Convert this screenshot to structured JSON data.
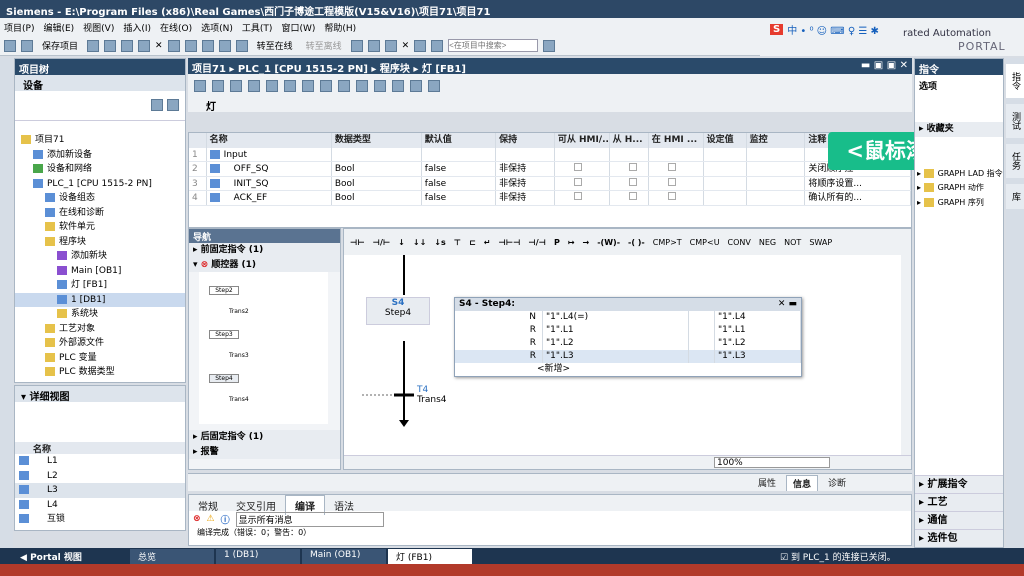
{
  "titlebar": {
    "app": "Siemens",
    "path": "E:\\Program Files (x86)\\Real Games\\西门子博途工程模版(V15&V16)\\项目71\\项目71"
  },
  "menu": [
    "项目(P)",
    "编辑(E)",
    "视图(V)",
    "插入(I)",
    "在线(O)",
    "选项(N)",
    "工具(T)",
    "窗口(W)",
    "帮助(H)"
  ],
  "toolbar": {
    "save": "保存项目",
    "go_online": "转至在线",
    "go_offline": "转至离线",
    "search_placeholder": "<在项目中搜索>"
  },
  "brand": {
    "line1": "rated Automation",
    "line2": "PORTAL"
  },
  "ime": {
    "logo": "S",
    "text": "中 • ⁰ ☺ ⌨ ♀ ☰ ✱"
  },
  "project_tree": {
    "title": "项目树",
    "tab": "设备",
    "items": [
      {
        "label": "项目71",
        "indent": 0,
        "icon": "folder"
      },
      {
        "label": "添加新设备",
        "indent": 1,
        "icon": "add-device"
      },
      {
        "label": "设备和网络",
        "indent": 1,
        "icon": "network"
      },
      {
        "label": "PLC_1 [CPU 1515-2 PN]",
        "indent": 1,
        "icon": "plc"
      },
      {
        "label": "设备组态",
        "indent": 2,
        "icon": "config"
      },
      {
        "label": "在线和诊断",
        "indent": 2,
        "icon": "diag"
      },
      {
        "label": "软件单元",
        "indent": 2,
        "icon": "folder"
      },
      {
        "label": "程序块",
        "indent": 2,
        "icon": "folder"
      },
      {
        "label": "添加新块",
        "indent": 3,
        "icon": "add"
      },
      {
        "label": "Main [OB1]",
        "indent": 3,
        "icon": "ob"
      },
      {
        "label": "灯 [FB1]",
        "indent": 3,
        "icon": "fb"
      },
      {
        "label": "1 [DB1]",
        "indent": 3,
        "icon": "db"
      },
      {
        "label": "系统块",
        "indent": 3,
        "icon": "folder"
      },
      {
        "label": "工艺对象",
        "indent": 2,
        "icon": "folder"
      },
      {
        "label": "外部源文件",
        "indent": 2,
        "icon": "folder"
      },
      {
        "label": "PLC 变量",
        "indent": 2,
        "icon": "folder"
      },
      {
        "label": "PLC 数据类型",
        "indent": 2,
        "icon": "folder"
      }
    ]
  },
  "detail_view": {
    "title": "详细视图",
    "column": "名称",
    "items": [
      "L1",
      "L2",
      "L3",
      "L4",
      "互锁"
    ]
  },
  "editor": {
    "breadcrumb": [
      "项目71",
      "PLC_1 [CPU 1515-2 PN]",
      "程序块",
      "灯 [FB1]"
    ],
    "block_name": "灯"
  },
  "interface": {
    "headers": [
      "名称",
      "数据类型",
      "默认值",
      "保持",
      "可从 HMI/...",
      "从 H...",
      "在 HMI ...",
      "设定值",
      "监控",
      "注释"
    ],
    "rows": [
      {
        "num": "1",
        "name": "Input",
        "type": "",
        "default": "",
        "retain": "",
        "comment": ""
      },
      {
        "num": "2",
        "name": "OFF_SQ",
        "type": "Bool",
        "default": "false",
        "retain": "非保持",
        "comment": "关闭顺序控"
      },
      {
        "num": "3",
        "name": "INIT_SQ",
        "type": "Bool",
        "default": "false",
        "retain": "非保持",
        "comment": "将顺序设置..."
      },
      {
        "num": "4",
        "name": "ACK_EF",
        "type": "Bool",
        "default": "false",
        "retain": "非保持",
        "comment": "确认所有的..."
      }
    ]
  },
  "navigation": {
    "title": "导航",
    "section1": "前固定指令 (1)",
    "section2": "顺控器 (1)",
    "section3": "后固定指令 (1)",
    "section4": "报警",
    "steps": [
      "Step2",
      "Trans2",
      "Step3",
      "Trans3",
      "Step4",
      "Trans4"
    ]
  },
  "graph": {
    "tools": [
      "CMP>T",
      "CMP<U",
      "CONV",
      "NEG",
      "NOT",
      "SWAP"
    ],
    "step": "S4",
    "step_name": "Step4",
    "trans": "T4",
    "trans_name": "Trans4",
    "zoom": "100%"
  },
  "popup": {
    "title": "S4 - Step4:",
    "rows": [
      {
        "q": "N",
        "op": "\"1\".L4(=)",
        "val": "\"1\".L4"
      },
      {
        "q": "R",
        "op": "\"1\".L1",
        "val": "\"1\".L1"
      },
      {
        "q": "R",
        "op": "\"1\".L2",
        "val": "\"1\".L2"
      },
      {
        "q": "R",
        "op": "\"1\".L3",
        "val": "\"1\".L3"
      }
    ],
    "add": "<新增>"
  },
  "overlay": {
    "text": "<鼠标滚动>"
  },
  "right_panel": {
    "options": "选项",
    "favorites": "收藏夹",
    "instructions": "指令",
    "items": [
      "GRAPH LAD 指令",
      "GRAPH 动作",
      "GRAPH 序列"
    ],
    "sections": [
      "扩展指令",
      "工艺",
      "通信",
      "选件包"
    ]
  },
  "vertical_tabs": [
    "指令",
    "测试",
    "任务",
    "库"
  ],
  "bottom": {
    "tabs": [
      "常规",
      "交叉引用",
      "编译",
      "语法"
    ],
    "right_tabs": [
      "属性",
      "信息",
      "诊断"
    ],
    "filter": "显示所有消息",
    "summary": "编译完成（错误：0；警告：0）"
  },
  "status": {
    "portal": "Portal 视图",
    "tasks": [
      "总览",
      "1 (DB1)",
      "Main (OB1)",
      "灯 (FB1)"
    ],
    "message": "到 PLC_1 的连接已关闭。"
  }
}
